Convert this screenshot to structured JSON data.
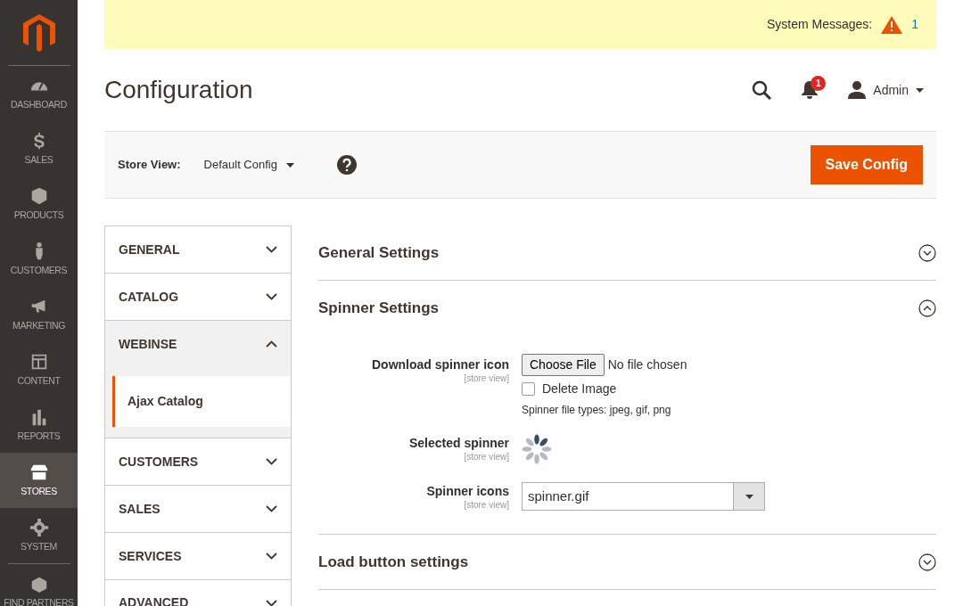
{
  "sidebar": {
    "items": [
      {
        "label": "DASHBOARD",
        "kind": "dashboard",
        "selected": false
      },
      {
        "label": "SALES",
        "kind": "sales",
        "selected": false
      },
      {
        "label": "PRODUCTS",
        "kind": "products",
        "selected": false
      },
      {
        "label": "CUSTOMERS",
        "kind": "customers",
        "selected": false
      },
      {
        "label": "MARKETING",
        "kind": "marketing",
        "selected": false
      },
      {
        "label": "CONTENT",
        "kind": "content",
        "selected": false
      },
      {
        "label": "REPORTS",
        "kind": "reports",
        "selected": false
      },
      {
        "label": "STORES",
        "kind": "stores",
        "selected": true
      },
      {
        "label": "SYSTEM",
        "kind": "system",
        "selected": false
      },
      {
        "label": "FIND PARTNERS",
        "kind": "partners",
        "selected": false
      }
    ]
  },
  "system_messages": {
    "label": "System Messages:",
    "count": "1"
  },
  "header": {
    "title": "Configuration",
    "notifications": "1",
    "user": "Admin"
  },
  "store_view": {
    "label": "Store View:",
    "value": "Default Config"
  },
  "save_button": "Save Config",
  "tabs": [
    {
      "label": "GENERAL",
      "expanded": false
    },
    {
      "label": "CATALOG",
      "expanded": false
    },
    {
      "label": "WEBINSE",
      "expanded": true,
      "children": [
        {
          "label": "Ajax Catalog",
          "selected": true
        }
      ]
    },
    {
      "label": "CUSTOMERS",
      "expanded": false
    },
    {
      "label": "SALES",
      "expanded": false
    },
    {
      "label": "SERVICES",
      "expanded": false
    },
    {
      "label": "ADVANCED",
      "expanded": false
    }
  ],
  "sections": [
    {
      "title": "General Settings",
      "expanded": false
    },
    {
      "title": "Spinner Settings",
      "expanded": true,
      "fields": [
        {
          "kind": "file",
          "label": "Download spinner icon",
          "scope": "[store view]",
          "button": "Choose File",
          "status": "No file chosen",
          "checkbox": {
            "label": "Delete Image",
            "checked": false
          },
          "note": "Spinner file types: jpeg, gif, png"
        },
        {
          "kind": "image",
          "label": "Selected spinner",
          "scope": "[store view]"
        },
        {
          "kind": "select",
          "label": "Spinner icons",
          "scope": "[store view]",
          "value": "spinner.gif"
        }
      ]
    },
    {
      "title": "Load button settings",
      "expanded": false
    }
  ]
}
